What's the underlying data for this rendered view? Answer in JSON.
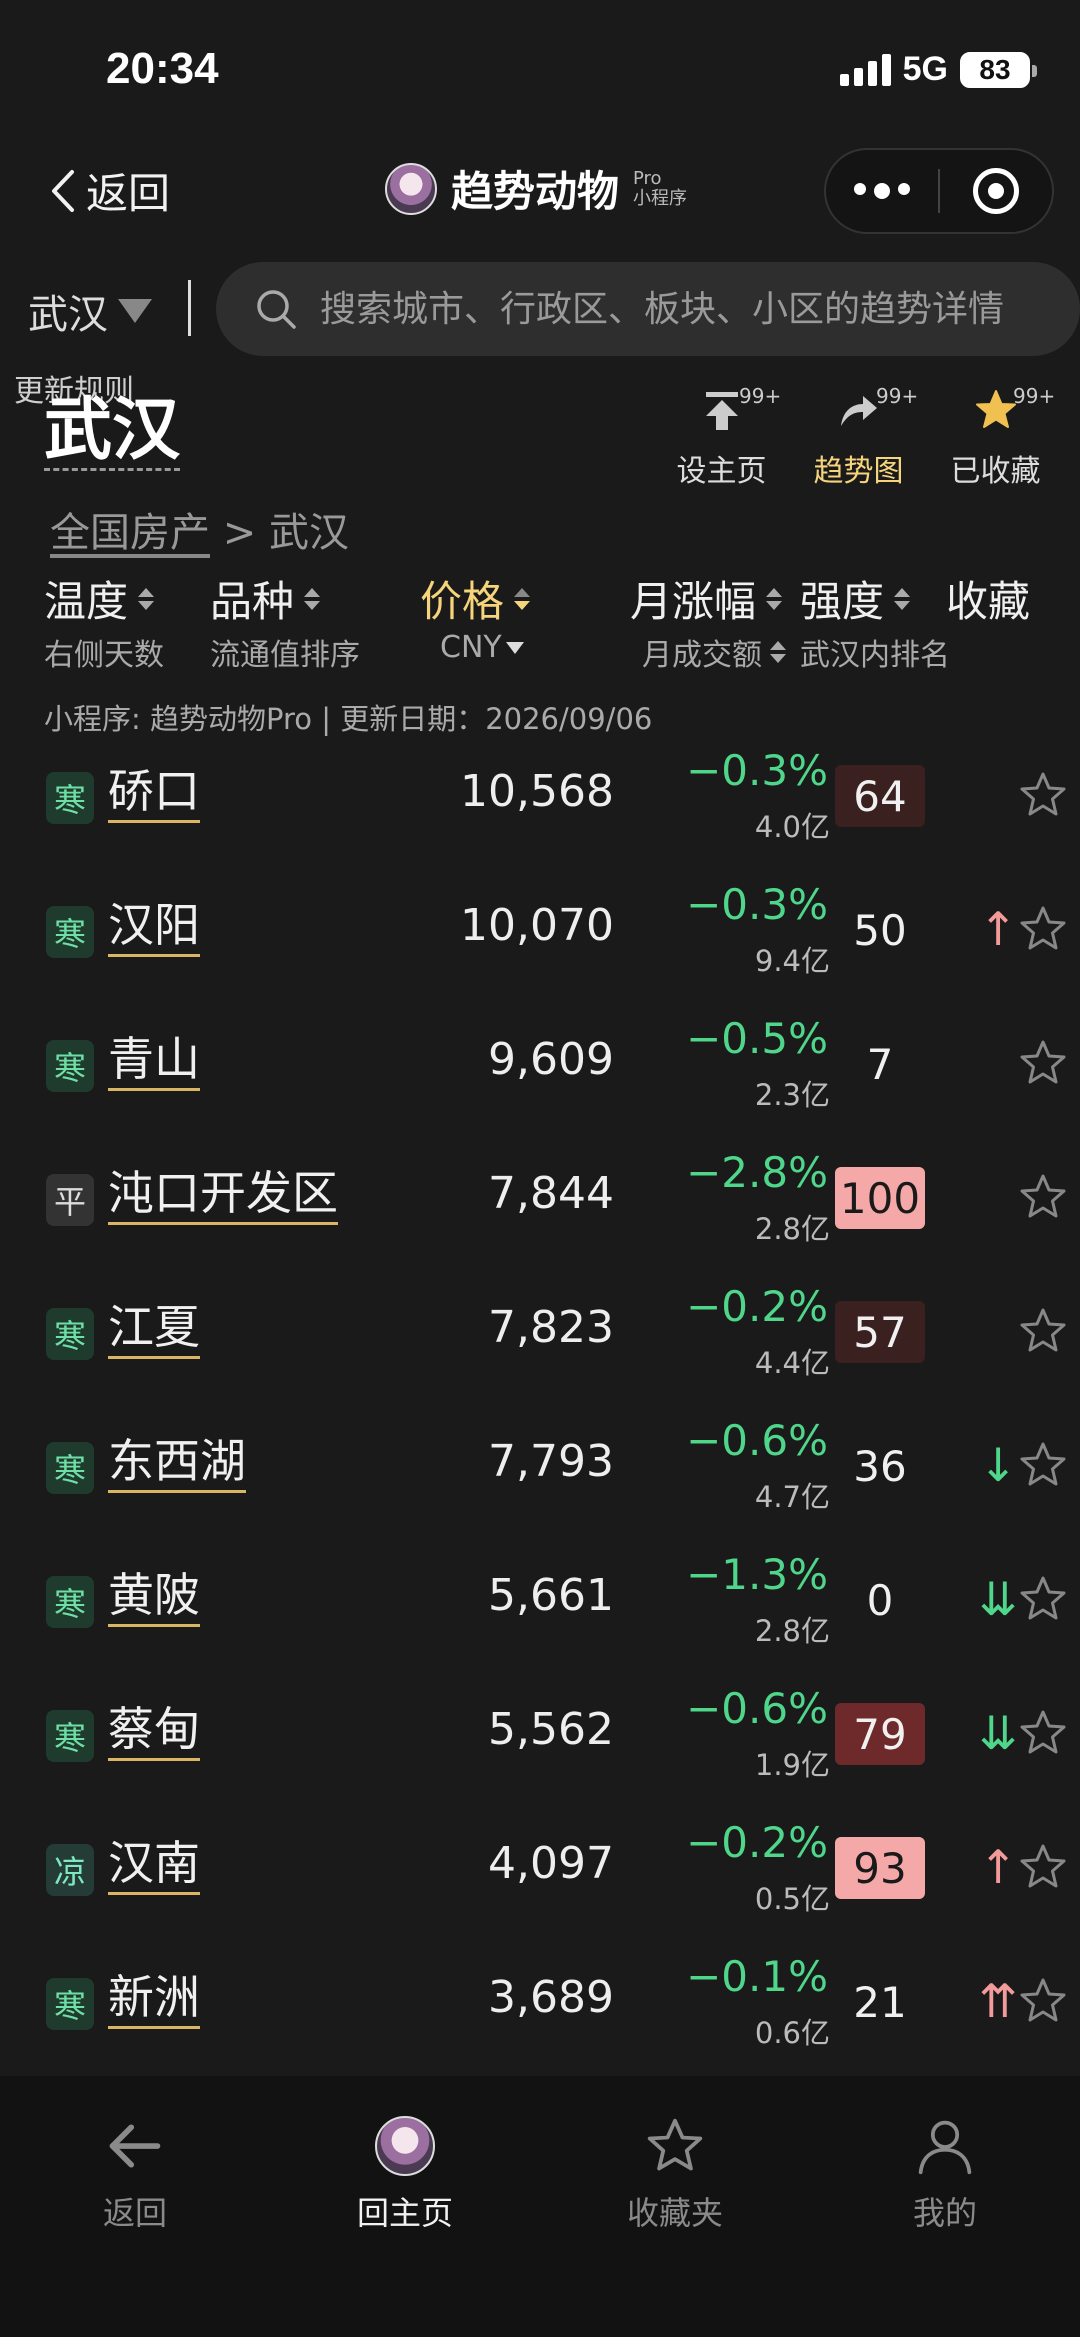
{
  "status": {
    "time": "20:34",
    "network": "5G",
    "battery": "83"
  },
  "nav": {
    "back_label": "返回",
    "title": "趋势动物",
    "title_sup": "Pro",
    "title_sub": "小程序"
  },
  "search": {
    "city": "武汉",
    "placeholder": "搜索城市、行政区、板块、小区的趋势详情"
  },
  "header": {
    "update_rule": "更新规则",
    "city": "武汉",
    "actions": [
      {
        "label": "设主页",
        "count": "99+",
        "icon": "pin-top-icon"
      },
      {
        "label": "趋势图",
        "count": "99+",
        "icon": "share-arrow-icon"
      },
      {
        "label": "已收藏",
        "count": "99+",
        "icon": "star-filled-icon"
      }
    ]
  },
  "breadcrumb": {
    "root": "全国房产",
    "separator": ">",
    "current": "武汉"
  },
  "columns": {
    "temp": {
      "label": "温度",
      "sub": "右侧天数"
    },
    "variety": {
      "label": "品种",
      "sub": "流通值排序"
    },
    "price": {
      "label": "价格",
      "sub": "CNY"
    },
    "change": {
      "label": "月涨幅",
      "sub": "月成交额"
    },
    "strength": {
      "label": "强度",
      "sub": "武汉内排名"
    },
    "fav": {
      "label": "收藏"
    }
  },
  "meta": "小程序: 趋势动物Pro | 更新日期：2026/09/06",
  "rows": [
    {
      "badge": "寒",
      "name": "硚口",
      "price": "10,568",
      "change": "−0.3%",
      "volume": "4.0亿",
      "score": "64",
      "level": 1,
      "trend": ""
    },
    {
      "badge": "寒",
      "name": "汉阳",
      "price": "10,070",
      "change": "−0.3%",
      "volume": "9.4亿",
      "score": "50",
      "level": 0,
      "trend": "↑"
    },
    {
      "badge": "寒",
      "name": "青山",
      "price": "9,609",
      "change": "−0.5%",
      "volume": "2.3亿",
      "score": "7",
      "level": 0,
      "trend": ""
    },
    {
      "badge": "平",
      "name": "沌口开发区",
      "price": "7,844",
      "change": "−2.8%",
      "volume": "2.8亿",
      "score": "100",
      "level": 3,
      "trend": ""
    },
    {
      "badge": "寒",
      "name": "江夏",
      "price": "7,823",
      "change": "−0.2%",
      "volume": "4.4亿",
      "score": "57",
      "level": 1,
      "trend": ""
    },
    {
      "badge": "寒",
      "name": "东西湖",
      "price": "7,793",
      "change": "−0.6%",
      "volume": "4.7亿",
      "score": "36",
      "level": 0,
      "trend": "↓"
    },
    {
      "badge": "寒",
      "name": "黄陂",
      "price": "5,661",
      "change": "−1.3%",
      "volume": "2.8亿",
      "score": "0",
      "level": 0,
      "trend": "⇊"
    },
    {
      "badge": "寒",
      "name": "蔡甸",
      "price": "5,562",
      "change": "−0.6%",
      "volume": "1.9亿",
      "score": "79",
      "level": 2,
      "trend": "⇊"
    },
    {
      "badge": "凉",
      "name": "汉南",
      "price": "4,097",
      "change": "−0.2%",
      "volume": "0.5亿",
      "score": "93",
      "level": 3,
      "trend": "↑"
    },
    {
      "badge": "寒",
      "name": "新洲",
      "price": "3,689",
      "change": "−0.1%",
      "volume": "0.6亿",
      "score": "21",
      "level": 0,
      "trend": "⇈"
    }
  ],
  "tabbar": [
    {
      "label": "返回",
      "icon": "arrow-left-icon"
    },
    {
      "label": "回主页",
      "icon": "logo-icon"
    },
    {
      "label": "收藏夹",
      "icon": "star-outline-icon"
    },
    {
      "label": "我的",
      "icon": "user-icon"
    }
  ],
  "colors": {
    "accent": "#f5d47c",
    "down": "#4fd68a",
    "up": "#f39a9a",
    "background": "#1a1a1a"
  }
}
